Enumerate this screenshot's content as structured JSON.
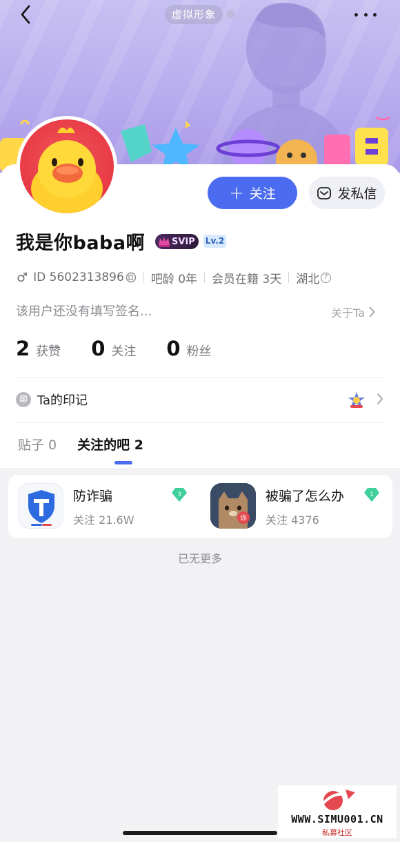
{
  "header": {
    "avatar_tag": "虚拟形象"
  },
  "profile": {
    "follow_label": "关注",
    "dm_label": "发私信",
    "username": "我是你baba啊",
    "svip_label": "SVIP",
    "level_label": "Lv.2",
    "gender_symbol": "♂",
    "id_text": "ID 5602313896",
    "bar_age": "吧龄 0年",
    "member_days": "会员在籍 3天",
    "location": "湖北",
    "signature": "该用户还没有填写签名...",
    "about_label": "关于Ta"
  },
  "stats": [
    {
      "num": "2",
      "label": "获赞"
    },
    {
      "num": "0",
      "label": "关注"
    },
    {
      "num": "0",
      "label": "粉丝"
    }
  ],
  "imprint": {
    "seal_char": "印",
    "label": "Ta的印记"
  },
  "tabs": [
    {
      "label": "贴子 0",
      "active": false
    },
    {
      "label": "关注的吧 2",
      "active": true
    }
  ],
  "forums": [
    {
      "name": "防诈骗",
      "followers": "关注 21.6W",
      "level": "3"
    },
    {
      "name": "被骗了怎么办",
      "followers": "关注 4376",
      "level": "1"
    }
  ],
  "footer": {
    "no_more": "已无更多"
  },
  "watermark": {
    "site": "WWW.SIMU001.CN",
    "sub": "私募社区"
  },
  "colors": {
    "accent": "#4b6cf0",
    "banner": "#b6abee",
    "avatar_red": "#e83a45",
    "gem_green": "#3fcf9a"
  }
}
